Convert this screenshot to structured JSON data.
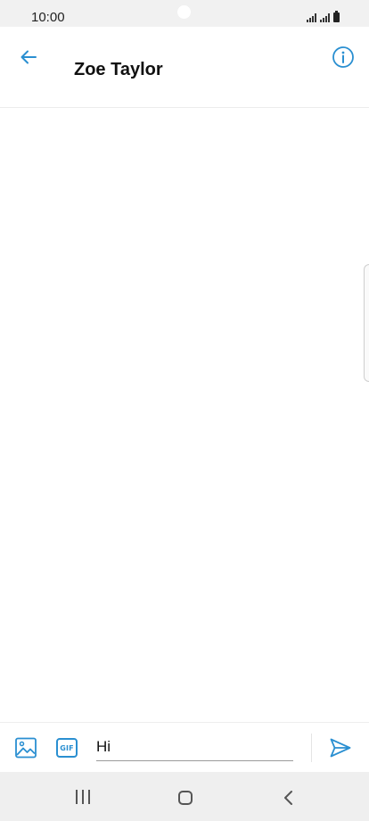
{
  "status_bar": {
    "time": "10:00"
  },
  "header": {
    "contact_name": "Zoe Taylor",
    "back_icon": "arrow-left-icon",
    "info_icon": "info-icon"
  },
  "compose": {
    "message_value": "Hi",
    "gallery_icon": "image-icon",
    "gif_label": "GIF",
    "send_icon": "send-icon"
  },
  "colors": {
    "accent": "#2a8fd1",
    "status_bar_bg": "#f1f1f1",
    "nav_bar_bg": "#efefef"
  }
}
